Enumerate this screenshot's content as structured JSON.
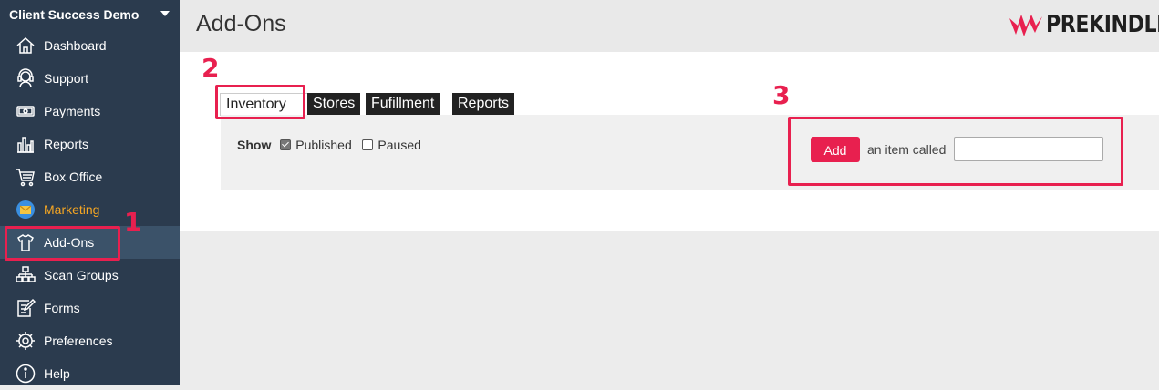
{
  "sidebar": {
    "org_name": "Client Success Demo",
    "items": [
      {
        "label": "Dashboard",
        "icon": "home-icon"
      },
      {
        "label": "Support",
        "icon": "headset-icon"
      },
      {
        "label": "Payments",
        "icon": "money-icon"
      },
      {
        "label": "Reports",
        "icon": "bar-chart-icon"
      },
      {
        "label": "Box Office",
        "icon": "cart-icon"
      },
      {
        "label": "Marketing",
        "icon": "mail-icon"
      },
      {
        "label": "Add-Ons",
        "icon": "tshirt-icon"
      },
      {
        "label": "Scan Groups",
        "icon": "org-chart-icon"
      },
      {
        "label": "Forms",
        "icon": "edit-form-icon"
      },
      {
        "label": "Preferences",
        "icon": "gear-icon"
      },
      {
        "label": "Help",
        "icon": "info-icon"
      }
    ]
  },
  "header": {
    "title": "Add-Ons",
    "logo_text": "PREKINDLE"
  },
  "tabs": [
    "Inventory",
    "Stores",
    "Fufillment",
    "Reports"
  ],
  "filter": {
    "show_label": "Show",
    "published_label": "Published",
    "published_checked": true,
    "paused_label": "Paused",
    "paused_checked": false
  },
  "add": {
    "button_label": "Add",
    "text": "an item called",
    "input_value": ""
  },
  "annotations": [
    "1",
    "2",
    "3"
  ],
  "colors": {
    "accent": "#e8204f",
    "sidebar_bg": "#2b3b4e",
    "marketing": "#f5a623"
  }
}
